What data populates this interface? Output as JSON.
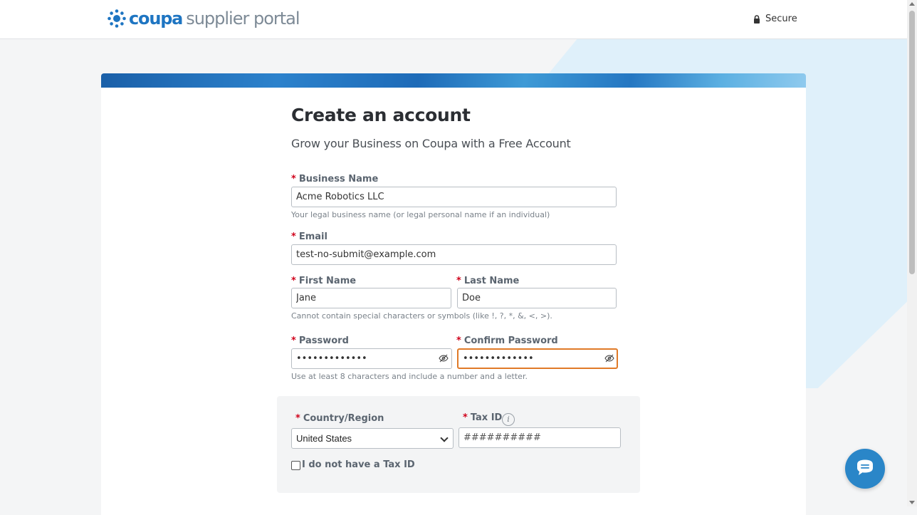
{
  "header": {
    "logo_brand": "coupa",
    "logo_product": "supplier portal",
    "secure_label": "Secure"
  },
  "form": {
    "title": "Create an account",
    "subtitle": "Grow your Business on Coupa with a Free Account",
    "required_marker": "*",
    "business_name": {
      "label": "Business Name",
      "value": "Acme Robotics LLC",
      "hint": "Your legal business name (or legal personal name if an individual)"
    },
    "email": {
      "label": "Email",
      "value": "test-no-submit@example.com"
    },
    "first_name": {
      "label": "First Name",
      "value": "Jane"
    },
    "last_name": {
      "label": "Last Name",
      "value": "Doe"
    },
    "name_hint": "Cannot contain special characters or symbols (like !, ?, *, &, <, >).",
    "password": {
      "label": "Password",
      "value": "•••••••••••••"
    },
    "confirm_password": {
      "label": "Confirm Password",
      "value": "•••••••••••••"
    },
    "password_hint": "Use at least 8 characters and include a number and a letter.",
    "country": {
      "label": "Country/Region",
      "value": "United States"
    },
    "tax_id": {
      "label": "Tax ID",
      "placeholder": "##########",
      "info_icon": "i"
    },
    "no_tax_id_label": "I do not have a Tax ID"
  },
  "colors": {
    "brand_blue": "#1e75c2",
    "required_red": "#d0021b",
    "focus_orange": "#e07a28",
    "chat_button": "#2a86c8"
  },
  "icons": [
    "lock-icon",
    "eye-slash-icon",
    "chevron-down-icon",
    "info-icon",
    "chat-icon"
  ]
}
